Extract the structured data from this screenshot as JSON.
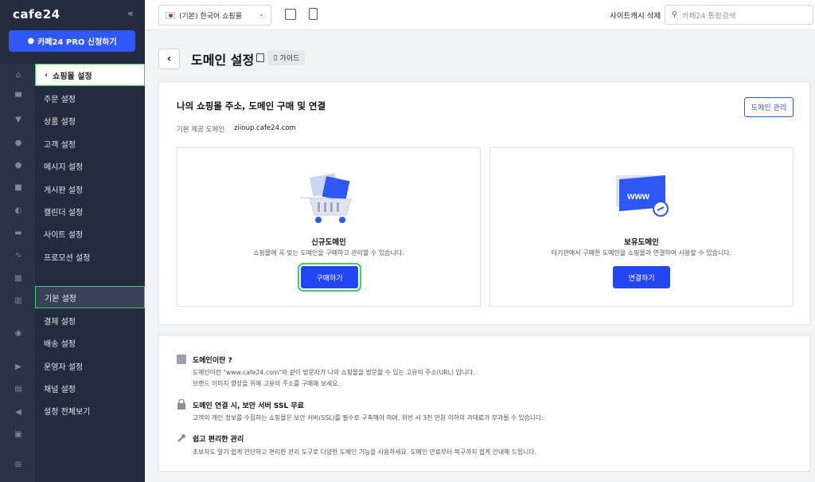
{
  "app": {
    "logo": "cafe24",
    "collapse": "«",
    "pro_button": "카페24 PRO 신청하기"
  },
  "sidebar": {
    "rail_icons": [
      "home-icon",
      "cart-icon",
      "shirt-icon",
      "user-icon",
      "chat-icon",
      "board-icon",
      "palette-icon",
      "image-icon",
      "chart-icon",
      "stats-icon",
      "book-icon",
      "badge-icon",
      "video-icon",
      "store-icon",
      "megaphone-icon",
      "cart-export-icon",
      "grid-plus-icon"
    ],
    "back_item": "쇼핑몰 설정",
    "items": [
      "주문 설정",
      "상품 설정",
      "고객 설정",
      "메시지 설정",
      "게시판 설정",
      "캘린더 설정",
      "사이트 설정",
      "프로모션 설정",
      "기본 설정",
      "결제 설정",
      "배송 설정",
      "운영자 설정",
      "채널 설정",
      "설정 전체보기"
    ]
  },
  "topbar": {
    "shop_select": "(기본) 한국어 쇼핑몰",
    "cache_delete": "사이트캐시 삭제",
    "search_placeholder": "카페24 통합검색"
  },
  "header": {
    "title": "도메인 설정",
    "guide": "가이드"
  },
  "domain": {
    "title": "나의 쇼핑몰 주소, 도메인 구매 및 연결",
    "manage_button": "도메인 관리",
    "default_label": "기본 제공 도메인",
    "default_value": "ziinup.cafe24.com",
    "cards": [
      {
        "title": "신규도메인",
        "desc": "쇼핑몰에 꼭 맞는 도메인을 구매하고 관리할 수 있습니다.",
        "button": "구매하기"
      },
      {
        "title": "보유도메인",
        "desc": "타기관에서 구매한 도메인을 쇼핑몰과 연결하여 사용할 수 있습니다.",
        "button": "연결하기",
        "illustration_text": "www"
      }
    ]
  },
  "info": [
    {
      "icon": "domain-card-icon",
      "title": "도메인이란 ?",
      "lines": [
        "도메인이란 \"www.cafe24.com\"와 같이 방문자가 나의 쇼핑몰을 방문할 수 있는 고유의 주소(URL) 입니다.",
        "브랜드 이미지 향상을 위해 고유의 주소를 구매해 보세요."
      ]
    },
    {
      "icon": "lock-icon",
      "title": "도메인 연결 시, 보안 서버 SSL 무료",
      "lines": [
        "고객의 개인 정보를 수집하는 쇼핑몰은 보안 서버(SSL)를 필수로 구축해야 하며, 위반 시 3천 만원 이하의 과태료가 부과될 수 있습니다."
      ]
    },
    {
      "icon": "wrench-icon",
      "title": "쉽고 편리한 관리",
      "lines": [
        "초보자도 알기 쉽게 간단하고 편리한 관리 도구로 다양한 도메인 기능을 사용하세요. 도메인 만료부터 복구까지 쉽게 안내해 드립니다."
      ]
    }
  ]
}
